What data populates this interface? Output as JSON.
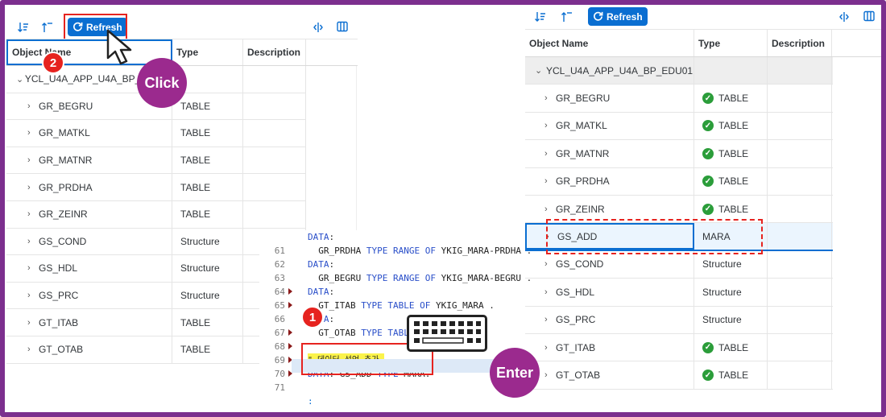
{
  "toolbar": {
    "sort_desc_icon": "sort-descending-icon",
    "sort_asc_icon": "sort-ascending-icon",
    "refresh_label": "Refresh",
    "split_icon": "split-columns-icon",
    "columns_icon": "columns-icon"
  },
  "columns": {
    "object_name": "Object Name",
    "type": "Type",
    "description": "Description"
  },
  "left_table": {
    "root": "YCL_U4A_APP_U4A_BP_EDU01",
    "rows": [
      {
        "name": "GR_BEGRU",
        "type": "TABLE"
      },
      {
        "name": "GR_MATKL",
        "type": "TABLE"
      },
      {
        "name": "GR_MATNR",
        "type": "TABLE"
      },
      {
        "name": "GR_PRDHA",
        "type": "TABLE"
      },
      {
        "name": "GR_ZEINR",
        "type": "TABLE"
      },
      {
        "name": "GS_COND",
        "type": "Structure"
      },
      {
        "name": "GS_HDL",
        "type": "Structure"
      },
      {
        "name": "GS_PRC",
        "type": "Structure"
      },
      {
        "name": "GT_ITAB",
        "type": "TABLE"
      },
      {
        "name": "GT_OTAB",
        "type": "TABLE"
      }
    ]
  },
  "right_table": {
    "root": "YCL_U4A_APP_U4A_BP_EDU01",
    "rows": [
      {
        "name": "GR_BEGRU",
        "type": "TABLE"
      },
      {
        "name": "GR_MATKL",
        "type": "TABLE"
      },
      {
        "name": "GR_MATNR",
        "type": "TABLE"
      },
      {
        "name": "GR_PRDHA",
        "type": "TABLE"
      },
      {
        "name": "GR_ZEINR",
        "type": "TABLE"
      },
      {
        "name": "GS_ADD",
        "type": "MARA"
      },
      {
        "name": "GS_COND",
        "type": "Structure"
      },
      {
        "name": "GS_HDL",
        "type": "Structure"
      },
      {
        "name": "GS_PRC",
        "type": "Structure"
      },
      {
        "name": "GT_ITAB",
        "type": "TABLE"
      },
      {
        "name": "GT_OTAB",
        "type": "TABLE"
      }
    ]
  },
  "editor": {
    "line_numbers": [
      "",
      "61",
      "62",
      "63",
      "64",
      "65",
      "66",
      "67",
      "68",
      "69",
      "70",
      "71"
    ],
    "lines": [
      "DATA:",
      "  GR_PRDHA TYPE RANGE OF YKIG_MARA-PRDHA .",
      "DATA:",
      "  GR_BEGRU TYPE RANGE OF YKIG_MARA-BEGRU .",
      "DATA:",
      "  GT_ITAB TYPE TABLE OF YKIG_MARA .",
      "DATA:",
      "  GT_OTAB TYPE TABLE",
      "",
      "\" 데이터 선언 추가.",
      "DATA: GS_ADD TYPE MARA.",
      "",
      ":"
    ]
  },
  "annotations": {
    "step1": "1",
    "step2": "2",
    "click_label": "Click",
    "enter_label": "Enter",
    "keyboard_icon": "keyboard-icon",
    "cursor_icon": "mouse-pointer-icon"
  },
  "colors": {
    "accent": "#0a6ed1",
    "highlight_red": "#e6231f",
    "purple": "#9b2a8e",
    "success": "#2b9d3a",
    "frame": "#7c2f8e"
  }
}
